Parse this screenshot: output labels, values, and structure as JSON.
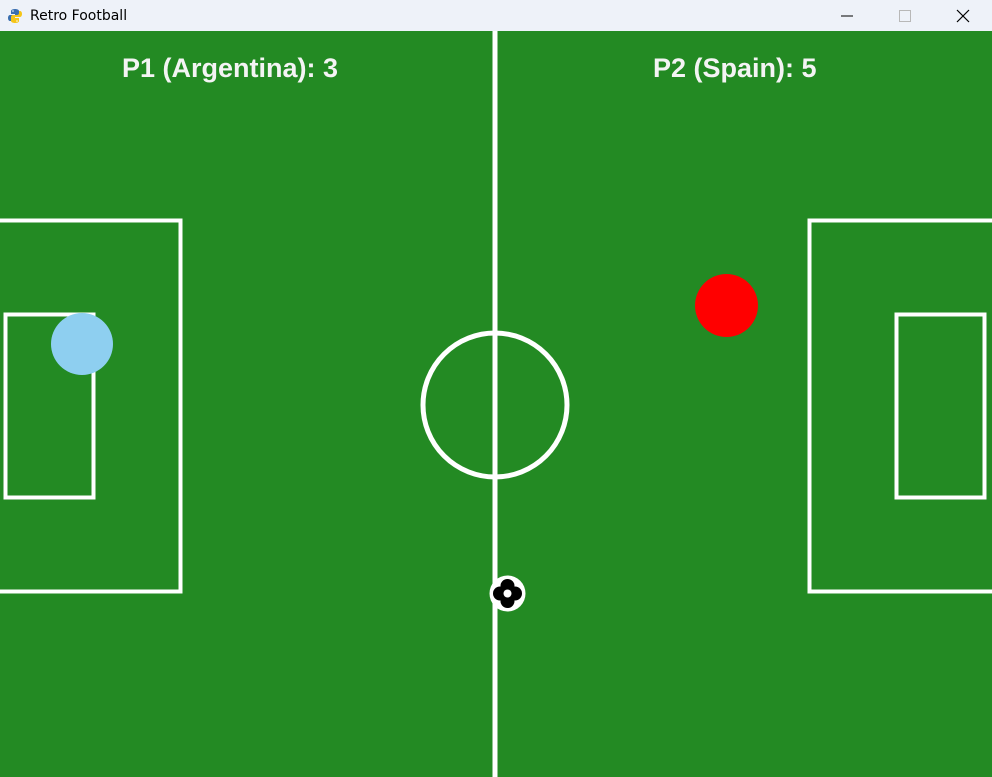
{
  "window": {
    "title": "Retro Football",
    "app_icon": "python-icon",
    "controls": [
      "minimize-icon",
      "maximize-icon",
      "close-icon"
    ]
  },
  "field": {
    "color": "#238a23",
    "line_color": "#ffffff"
  },
  "scores": {
    "p1_text": "P1 (Argentina): 3",
    "p2_text": "P2 (Spain): 5"
  },
  "players": {
    "p1": {
      "color": "#8ecff0"
    },
    "p2": {
      "color": "#ff0000"
    }
  },
  "ball": {
    "icon": "soccer-ball-icon"
  }
}
